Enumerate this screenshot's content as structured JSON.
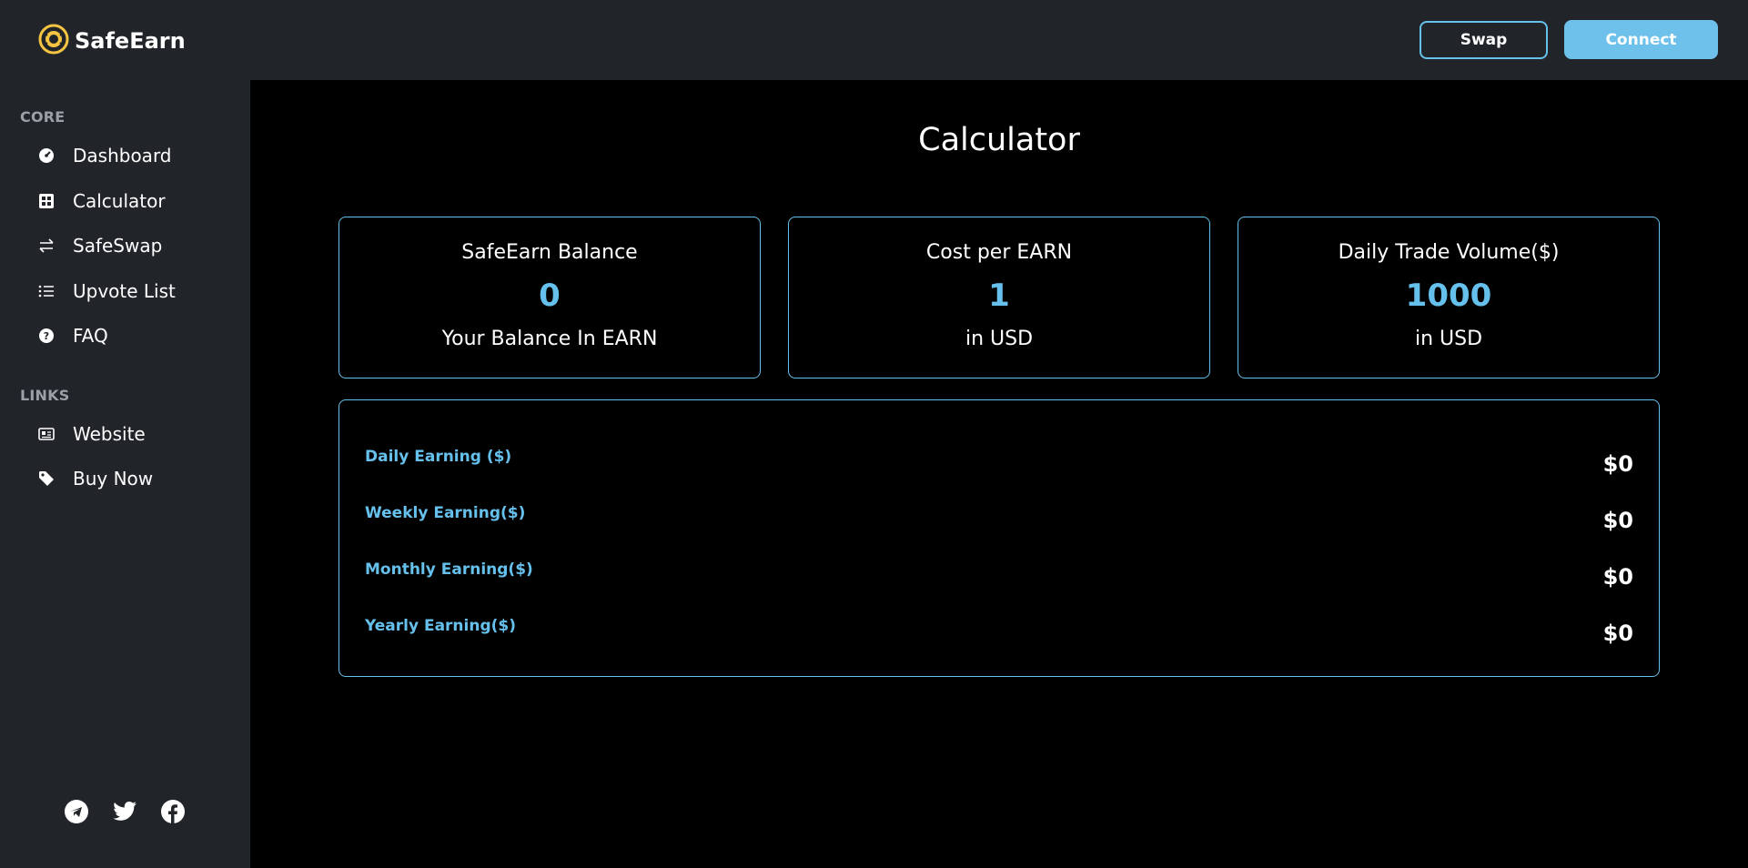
{
  "header": {
    "brand": "SafeEarn",
    "swap_label": "Swap",
    "connect_label": "Connect",
    "accent_color": "#66c0ec",
    "logo_color": "#f5c542"
  },
  "sidebar": {
    "core_label": "CORE",
    "links_label": "LINKS",
    "core_items": [
      {
        "label": "Dashboard",
        "icon": "speedometer-icon"
      },
      {
        "label": "Calculator",
        "icon": "calculator-icon"
      },
      {
        "label": "SafeSwap",
        "icon": "swap-arrows-icon"
      },
      {
        "label": "Upvote List",
        "icon": "list-icon"
      },
      {
        "label": "FAQ",
        "icon": "question-circle-icon"
      }
    ],
    "link_items": [
      {
        "label": "Website",
        "icon": "newspaper-icon"
      },
      {
        "label": "Buy Now",
        "icon": "tag-icon"
      }
    ],
    "socials": [
      "telegram-icon",
      "twitter-icon",
      "facebook-icon"
    ]
  },
  "main": {
    "title": "Calculator",
    "cards": [
      {
        "title": "SafeEarn Balance",
        "value": "0",
        "sub": "Your Balance In EARN"
      },
      {
        "title": "Cost per EARN",
        "value": "1",
        "sub": "in USD"
      },
      {
        "title": "Daily Trade Volume($)",
        "value": "1000",
        "sub": "in USD"
      }
    ],
    "earnings": [
      {
        "label": "Daily Earning ($)",
        "value": "$0"
      },
      {
        "label": "Weekly Earning($)",
        "value": "$0"
      },
      {
        "label": "Monthly Earning($)",
        "value": "$0"
      },
      {
        "label": "Yearly Earning($)",
        "value": "$0"
      }
    ]
  }
}
